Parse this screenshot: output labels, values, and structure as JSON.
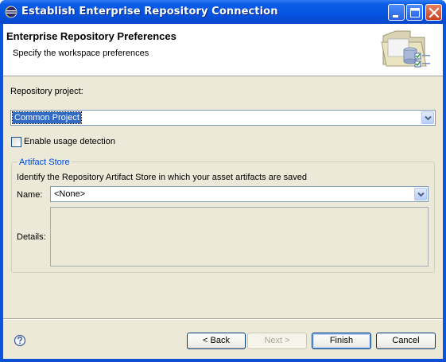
{
  "window": {
    "title": "Establish Enterprise Repository Connection",
    "controls": {
      "minimize": "minimize-icon",
      "maximize": "maximize-icon",
      "close": "close-icon"
    }
  },
  "banner": {
    "title": "Enterprise Repository Preferences",
    "subtitle": "Specify the workspace preferences",
    "icon": "repository-wizard-icon"
  },
  "form": {
    "repository_project_label": "Repository project:",
    "repository_project_value": "Common Project",
    "usage_detection_label": "Enable usage detection",
    "usage_detection_checked": false
  },
  "artifact_store": {
    "group_title": "Artifact Store",
    "description": "Identify the Repository Artifact Store in which your asset artifacts are saved",
    "name_label": "Name:",
    "name_value": "<None>",
    "details_label": "Details:",
    "details_value": ""
  },
  "footer": {
    "help_icon": "help-icon",
    "back_label": "< Back",
    "next_label": "Next >",
    "finish_label": "Finish",
    "cancel_label": "Cancel"
  },
  "colors": {
    "titlebar": "#0553e0",
    "dialog_bg": "#ece9d8",
    "selection": "#316ac5",
    "group_title": "#0046d5"
  }
}
